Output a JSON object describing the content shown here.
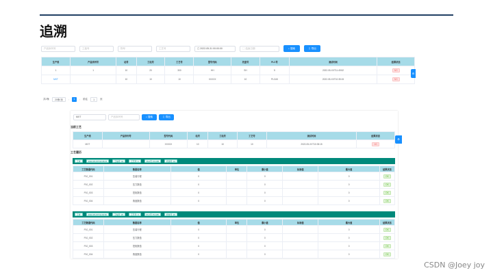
{
  "slide_title": "追溯",
  "filters": [
    {
      "placeholder": "产品序列号"
    },
    {
      "placeholder": "工装号"
    },
    {
      "placeholder": "物号"
    },
    {
      "placeholder": "工艺号"
    },
    {
      "value": "2022-05-31 00:00:00"
    },
    {
      "placeholder": "结束日期"
    }
  ],
  "buttons": {
    "search": "搜索",
    "export": "导出"
  },
  "main_table": {
    "headers": [
      "生产线",
      "产品序列号",
      "站号",
      "工站号",
      "工艺号",
      "型号代码",
      "托盘号",
      "PLC号",
      "测试时间",
      "结果状态"
    ],
    "rows": [
      [
        "1",
        "1",
        "10",
        "20",
        "300",
        "HH",
        "SH",
        "5",
        "2022-05-XXT11:49:52",
        "NG"
      ],
      [
        "MXT",
        "",
        "10",
        "10",
        "10",
        "XXXXX",
        "10",
        "PLC#5",
        "2022-05-XXT10:35:15",
        "NG"
      ]
    ]
  },
  "pager": {
    "total": "共2条",
    "page_size": "20条/页",
    "page": "1",
    "goto_label": "前往",
    "goto_value": "1",
    "page_unit": "页"
  },
  "detail": {
    "search_value": "MXT",
    "search_placeholder": "产品序列号",
    "section_current": "当前工艺",
    "section_history": "工艺履历",
    "table": {
      "headers": [
        "生产线",
        "产品序列号",
        "型号代码",
        "站号",
        "工站号",
        "工艺号",
        "测试时间",
        "结果状态"
      ],
      "row": [
        "MXT",
        "",
        "XXXXX",
        "10",
        "10",
        "10",
        "2022-05-XXT10:35:15",
        "NG"
      ]
    },
    "groups": [
      {
        "tags": [
          "工步",
          "2022-05-XXT10:35:15",
          "工站号: 10",
          "工艺号: 1",
          "PLC号: PLC#5",
          "托盘号: 10"
        ],
        "headers": [
          "工艺数据代码",
          "数据名称",
          "值",
          "单位",
          "最小值",
          "标准值",
          "最大值",
          "结果状态"
        ],
        "rows": [
          [
            "P10_001",
            "压装行程",
            "0",
            "",
            "0",
            "",
            "0",
            "OK"
          ],
          [
            "P10_002",
            "压力数值",
            "0",
            "",
            "0",
            "",
            "0",
            "OK"
          ],
          [
            "P10_003",
            "扭矩数值",
            "0",
            "",
            "0",
            "",
            "0",
            "OK"
          ],
          [
            "P10_004",
            "角度数值",
            "0",
            "",
            "0",
            "",
            "0",
            "OK"
          ]
        ]
      },
      {
        "tags": [
          "工步",
          "2022-05-XXT11:49:52",
          "工站号: 20",
          "工艺号: 3",
          "PLC号: PLC#5",
          "托盘号: 20"
        ],
        "headers": [
          "工艺数据代码",
          "数据名称",
          "值",
          "单位",
          "最小值",
          "标准值",
          "最大值",
          "结果状态"
        ],
        "rows": [
          [
            "P10_001",
            "压装行程",
            "0",
            "",
            "0",
            "",
            "0",
            "OK"
          ],
          [
            "P10_002",
            "压力数值",
            "0",
            "",
            "0",
            "",
            "0",
            "OK"
          ],
          [
            "P10_003",
            "扭矩数值",
            "0",
            "",
            "0",
            "",
            "0",
            "OK"
          ],
          [
            "P10_004",
            "角度数值",
            "0",
            "",
            "0",
            "",
            "0",
            "OK"
          ]
        ]
      }
    ]
  },
  "watermark": "CSDN @Joey joy"
}
